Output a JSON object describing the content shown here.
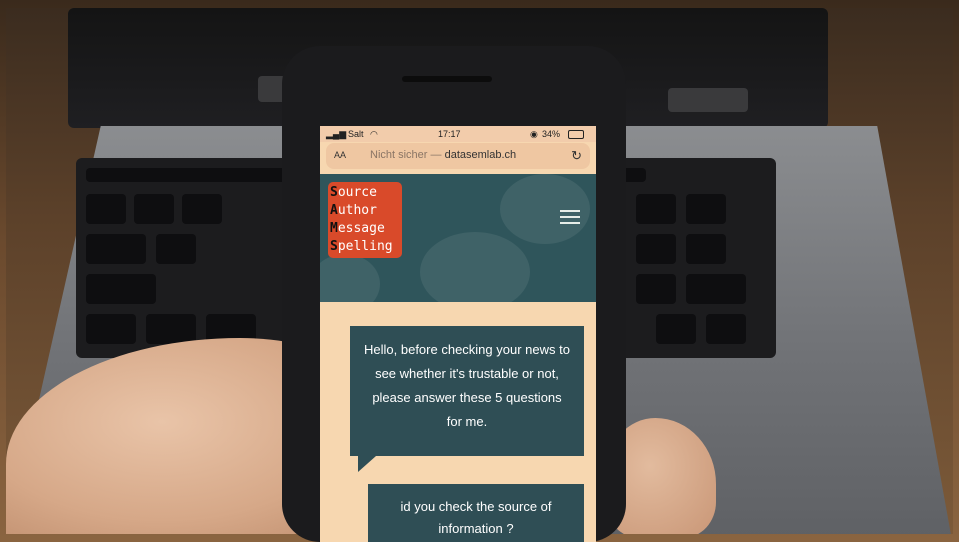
{
  "status_bar": {
    "carrier": "Salt",
    "time": "17:17",
    "battery": "34%"
  },
  "browser": {
    "text_size_label": "AA",
    "security_label": "Nicht sicher —",
    "domain": "datasemlab.ch",
    "reload_icon": "reload-icon"
  },
  "site": {
    "logo": {
      "rows": [
        {
          "initial": "S",
          "rest": "ource"
        },
        {
          "initial": "A",
          "rest": "uthor"
        },
        {
          "initial": "M",
          "rest": "essage"
        },
        {
          "initial": "S",
          "rest": "pelling"
        }
      ]
    },
    "menu_icon": "hamburger-menu-icon",
    "chat_message": "Hello, before checking your news to see whether it's trustable or not, please answer these 5 questions for me.",
    "question": "id you check the source of information ?"
  },
  "colors": {
    "header_teal": "#2f555b",
    "logo_red": "#d94a2a",
    "page_peach": "#f7d7b0",
    "bubble_dark": "#2f4e55"
  }
}
